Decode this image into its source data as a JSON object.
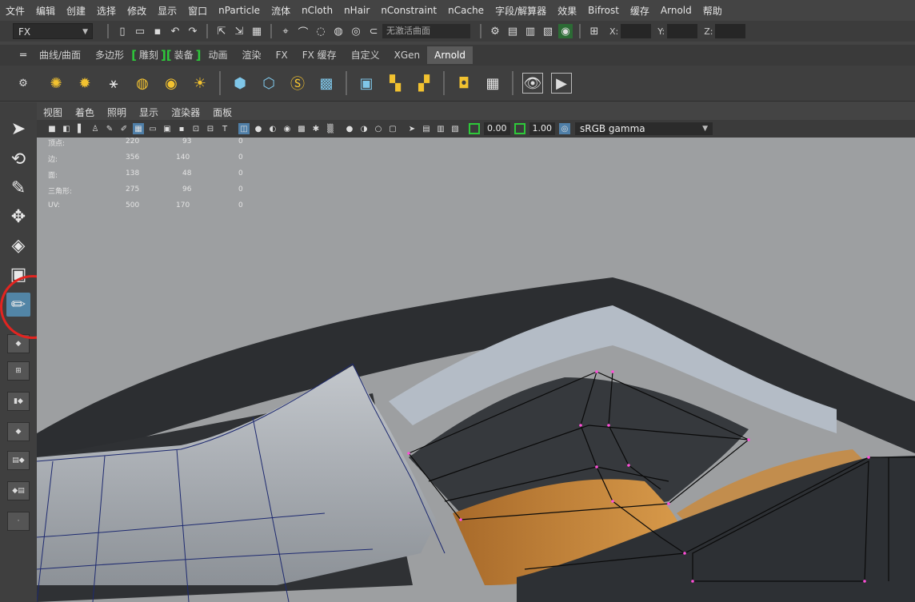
{
  "menubar": [
    "文件",
    "编辑",
    "创建",
    "选择",
    "修改",
    "显示",
    "窗口",
    "nParticle",
    "流体",
    "nCloth",
    "nHair",
    "nConstraint",
    "nCache",
    "字段/解算器",
    "效果",
    "Bifrost",
    "缓存",
    "Arnold",
    "帮助"
  ],
  "statusline": {
    "menuset": "FX",
    "live_surface": "无激活曲面",
    "coords": [
      "X:",
      "Y:",
      "Z:"
    ]
  },
  "shelf_tabs": [
    "曲线/曲面",
    "多边形",
    "雕刻",
    "装备",
    "动画",
    "渲染",
    "FX",
    "FX 缓存",
    "自定义",
    "XGen",
    "Arnold"
  ],
  "active_shelf": "Arnold",
  "panel_menu": [
    "视图",
    "着色",
    "照明",
    "显示",
    "渲染器",
    "面板"
  ],
  "panel_toolbar": {
    "exposure": "0.00",
    "gamma": "1.00",
    "color_space": "sRGB gamma"
  },
  "hud": [
    {
      "label": "顶点:",
      "a": "220",
      "b": "93",
      "c": "0"
    },
    {
      "label": "边:",
      "a": "356",
      "b": "140",
      "c": "0"
    },
    {
      "label": "面:",
      "a": "138",
      "b": "48",
      "c": "0"
    },
    {
      "label": "三角形:",
      "a": "275",
      "b": "96",
      "c": "0"
    },
    {
      "label": "UV:",
      "a": "500",
      "b": "170",
      "c": "0"
    }
  ],
  "colors": {
    "accent_active": "#5285a6",
    "highlight_circle": "#e32420",
    "bracket_green": "#2ec93a"
  },
  "icons": {
    "toolbox": [
      "select-arrow-icon",
      "lasso-icon",
      "paint-select-icon",
      "move-icon",
      "rotate-icon",
      "scale-icon",
      "quad-draw-icon"
    ]
  }
}
